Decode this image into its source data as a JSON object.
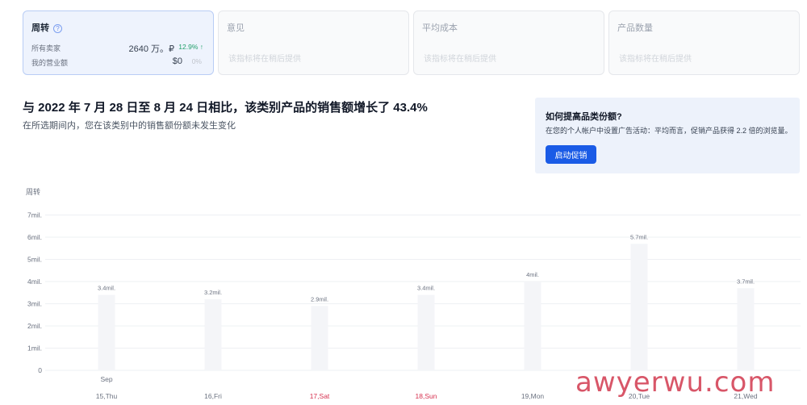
{
  "tabs": [
    {
      "title": "周转",
      "active": true
    },
    {
      "title": "意见",
      "note": "该指标将在稍后提供"
    },
    {
      "title": "平均成本",
      "note": "该指标将在稍后提供"
    },
    {
      "title": "产品数量",
      "note": "该指标将在稍后提供"
    }
  ],
  "turnover": {
    "all_sellers_label": "所有卖家",
    "all_sellers_value": "2640 万。₽",
    "all_sellers_change": "12.9% ↑",
    "my_revenue_label": "我的营业额",
    "my_revenue_value": "$0",
    "my_revenue_change": "0%"
  },
  "headline": "与 2022 年 7 月 28 日至 8 月 24 日相比，该类别产品的销售额增长了 43.4%",
  "subtext": "在所选期间内，您在该类别中的销售额份额未发生变化",
  "promo": {
    "title": "如何提高品类份额?",
    "text": "在您的个人帐户中设置广告活动：平均而言，促销产品获得 2.2 倍的浏览量。",
    "button": "启动促销"
  },
  "chart_data": {
    "type": "bar",
    "ylabel": "周转",
    "y_ticks": [
      "0",
      "1mil.",
      "2mil.",
      "3mil.",
      "4mil.",
      "5mil.",
      "6mil.",
      "7mil."
    ],
    "ylim": [
      0,
      7
    ],
    "categories": [
      "15,Thu",
      "16,Fri",
      "17,Sat",
      "18,Sun",
      "19,Mon",
      "20,Tue",
      "21,Wed"
    ],
    "weekend": [
      false,
      false,
      true,
      true,
      false,
      false,
      false
    ],
    "values": [
      3.4,
      3.2,
      2.9,
      3.4,
      4.0,
      5.7,
      3.7
    ],
    "data_labels": [
      "3.4mil.",
      "3.2mil.",
      "2.9mil.",
      "3.4mil.",
      "4mil.",
      "5.7mil.",
      "3.7mil."
    ],
    "month_label": "Sep",
    "colors": {
      "bar": "#f4f5f8",
      "weekend_label": "#d6304f",
      "grid": "#eef0f3"
    }
  },
  "watermark": "awyerwu.com"
}
